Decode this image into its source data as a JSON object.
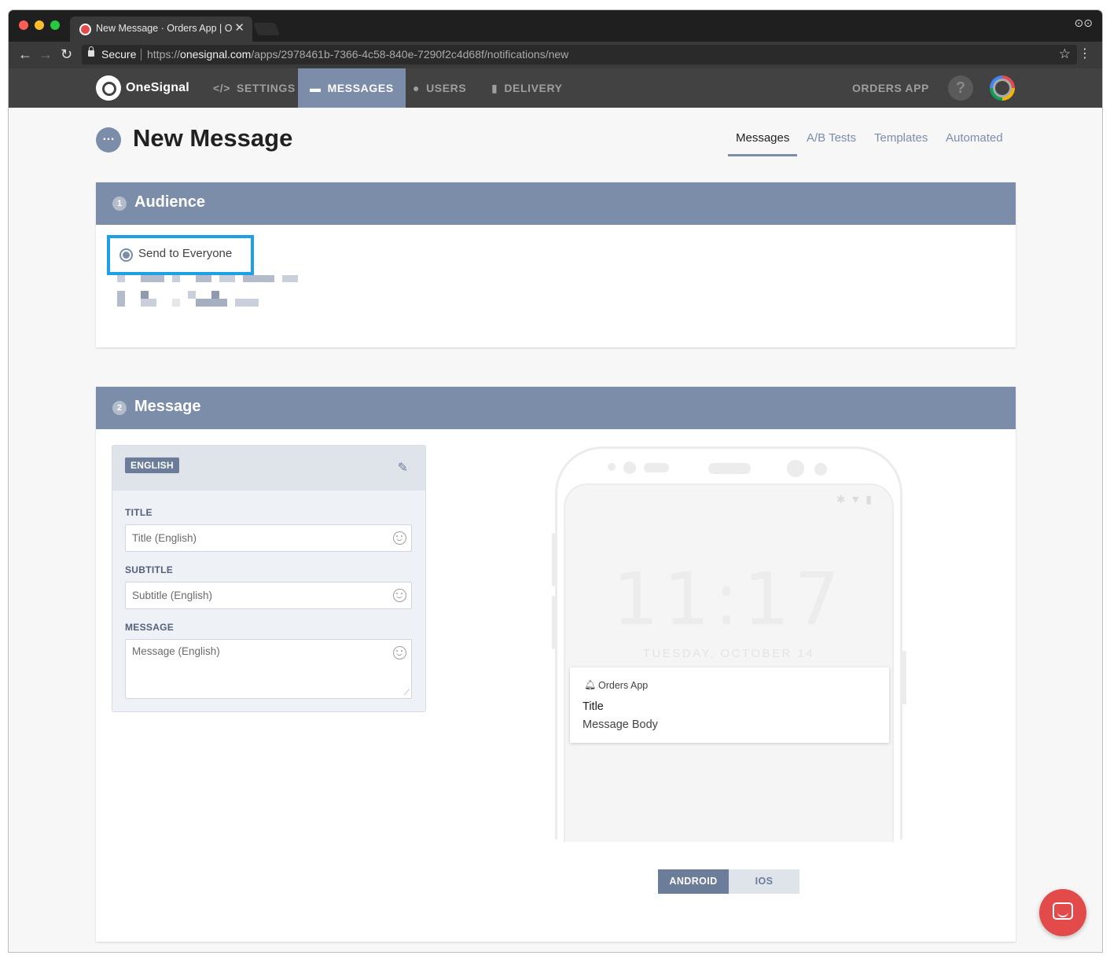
{
  "browser": {
    "tab_title": "New Message · Orders App | O",
    "tab_close": "✕",
    "secure_label": "Secure",
    "url_scheme": "https://",
    "url_host": "onesignal.com",
    "url_path": "/apps/2978461b-7366-4c58-840e-7290f2c4d68f/notifications/new"
  },
  "appnav": {
    "logo": "OneSignal",
    "items": [
      {
        "label": "SETTINGS",
        "icon": "code-icon",
        "glyph": "</>"
      },
      {
        "label": "MESSAGES",
        "icon": "chat-icon",
        "glyph": "▬"
      },
      {
        "label": "USERS",
        "icon": "users-icon",
        "glyph": "●"
      },
      {
        "label": "DELIVERY",
        "icon": "bar-chart-icon",
        "glyph": "▮"
      }
    ],
    "app_name": "ORDERS APP",
    "help": "?"
  },
  "page": {
    "title": "New Message",
    "subtabs": [
      "Messages",
      "A/B Tests",
      "Templates",
      "Automated"
    ]
  },
  "audience": {
    "step": "1",
    "title": "Audience",
    "option": "Send to Everyone"
  },
  "message": {
    "step": "2",
    "title": "Message",
    "language": "ENGLISH",
    "fields": [
      {
        "label": "TITLE",
        "placeholder": "Title (English)"
      },
      {
        "label": "SUBTITLE",
        "placeholder": "Subtitle (English)"
      },
      {
        "label": "MESSAGE",
        "placeholder": "Message (English)"
      }
    ]
  },
  "preview": {
    "time": "11:17",
    "date": "TUESDAY, OCTOBER 14",
    "app_name": "Orders App",
    "title": "Title",
    "body": "Message Body",
    "platforms": [
      "ANDROID",
      "IOS"
    ],
    "selected_platform": "ANDROID"
  },
  "colors": {
    "accent": "#7b8da8",
    "nav_bg": "#424242",
    "highlight": "#1ea0e8",
    "chat": "#e34b4b"
  }
}
